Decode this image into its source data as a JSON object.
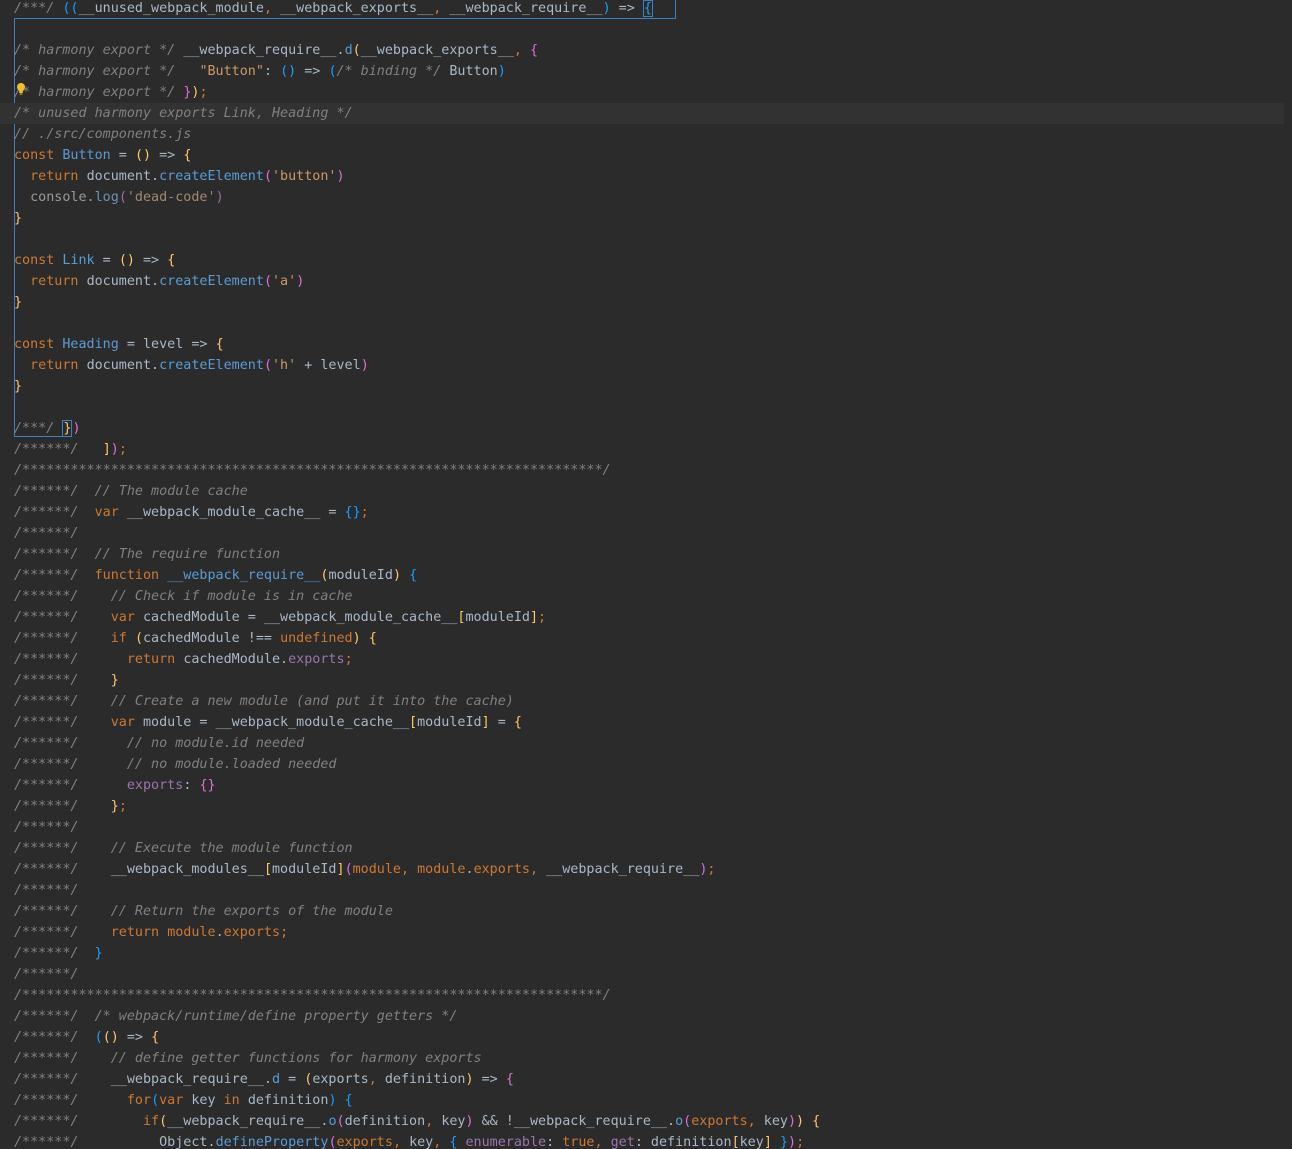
{
  "editor": {
    "lines": [
      "/***/ ((__unused_webpack_module, __webpack_exports__, __webpack_require__) => {",
      "",
      "/* harmony export */ __webpack_require__.d(__webpack_exports__, {",
      "/* harmony export */   \"Button\": () => (/* binding */ Button)",
      "/* harmony export */ });",
      "/* unused harmony exports Link, Heading */",
      "// ./src/components.js",
      "const Button = () => {",
      "  return document.createElement('button')",
      "  console.log('dead-code')",
      "}",
      "",
      "const Link = () => {",
      "  return document.createElement('a')",
      "}",
      "",
      "const Heading = level => {",
      "  return document.createElement('h' + level)",
      "}",
      "",
      "/***/ })",
      "/******/ \t]);",
      "/************************************************************************/",
      "/******/ \t// The module cache",
      "/******/ \tvar __webpack_module_cache__ = {};",
      "/******/ \t",
      "/******/ \t// The require function",
      "/******/ \tfunction __webpack_require__(moduleId) {",
      "/******/ \t\t// Check if module is in cache",
      "/******/ \t\tvar cachedModule = __webpack_module_cache__[moduleId];",
      "/******/ \t\tif (cachedModule !== undefined) {",
      "/******/ \t\t\treturn cachedModule.exports;",
      "/******/ \t\t}",
      "/******/ \t\t// Create a new module (and put it into the cache)",
      "/******/ \t\tvar module = __webpack_module_cache__[moduleId] = {",
      "/******/ \t\t\t// no module.id needed",
      "/******/ \t\t\t// no module.loaded needed",
      "/******/ \t\t\texports: {}",
      "/******/ \t\t};",
      "/******/ \t",
      "/******/ \t\t// Execute the module function",
      "/******/ \t\t__webpack_modules__[moduleId](module, module.exports, __webpack_require__);",
      "/******/ \t",
      "/******/ \t\t// Return the exports of the module",
      "/******/ \t\treturn module.exports;",
      "/******/ \t}",
      "/******/ \t",
      "/************************************************************************/",
      "/******/ \t/* webpack/runtime/define property getters */",
      "/******/ \t(() => {",
      "/******/ \t\t// define getter functions for harmony exports",
      "/******/ \t\t__webpack_require__.d = (exports, definition) => {",
      "/******/ \t\t\tfor(var key in definition) {",
      "/******/ \t\t\t\tif(__webpack_require__.o(definition, key) && !__webpack_require__.o(exports, key)) {",
      "/******/ \t\t\t\t\tObject.defineProperty(exports, key, { enumerable: true, get: definition[key] });"
    ]
  },
  "colors": {
    "background": "#2b2b2b",
    "comment": "#808080",
    "keyword": "#cc7832",
    "function": "#5a9bd5",
    "property": "#9876aa",
    "string": "#cc9966",
    "selection_border": "#3f7fc0"
  },
  "icons": {
    "intention": "lightbulb-icon"
  }
}
